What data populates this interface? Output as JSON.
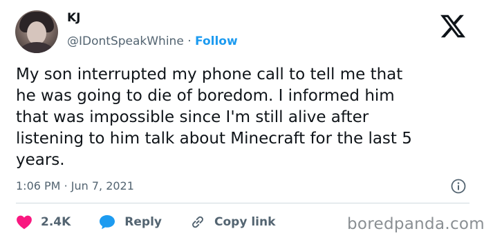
{
  "user": {
    "name": "KJ",
    "handle": "@IDontSpeakWhine",
    "separator": "·",
    "follow_label": "Follow"
  },
  "platform_logo": "x-logo-icon",
  "tweet": {
    "text": "My son interrupted my phone call to tell me that\nhe was going to die of boredom. I informed him\nthat was impossible since I'm still alive after\nlistening to him talk about Minecraft for the last 5\nyears.",
    "time": "1:06 PM",
    "date_separator": "·",
    "date": "Jun 7, 2021"
  },
  "actions": {
    "like_count": "2.4K",
    "reply_label": "Reply",
    "copy_link_label": "Copy link"
  },
  "watermark": "boredpanda.com",
  "colors": {
    "text": "#0f1419",
    "secondary": "#536471",
    "follow": "#1d9bf0",
    "like": "#f91880",
    "reply": "#1d9bf0"
  }
}
